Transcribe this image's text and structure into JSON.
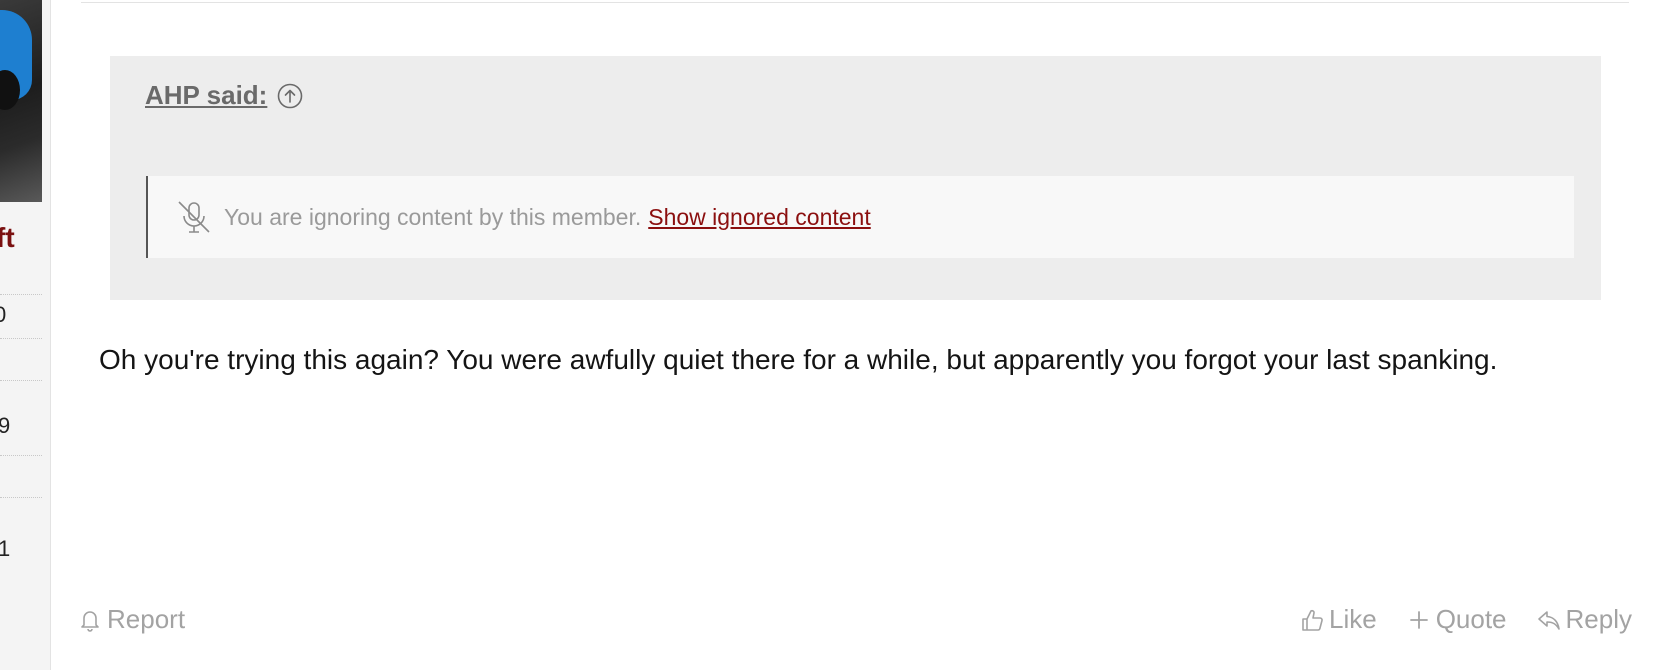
{
  "sidebar": {
    "name_fragment": "ft",
    "stats": [
      "0",
      "9",
      "1"
    ]
  },
  "quote": {
    "author": "AHP said:",
    "ignored_text": "You are ignoring content by this member.",
    "show_link": "Show ignored content"
  },
  "message": {
    "text": "Oh you're trying this again? You were awfully quiet there for a while, but apparently you forgot your last spanking."
  },
  "actions": {
    "report": "Report",
    "like": "Like",
    "quote": "Quote",
    "reply": "Reply"
  },
  "colors": {
    "link": "#8b0f0f",
    "muted": "#a3a3a3",
    "quote_bg": "#ededed"
  },
  "icons": [
    "jump-to-quote-icon",
    "muted-microphone-icon",
    "bell-icon",
    "thumbs-up-icon",
    "plus-icon",
    "reply-arrow-icon"
  ]
}
